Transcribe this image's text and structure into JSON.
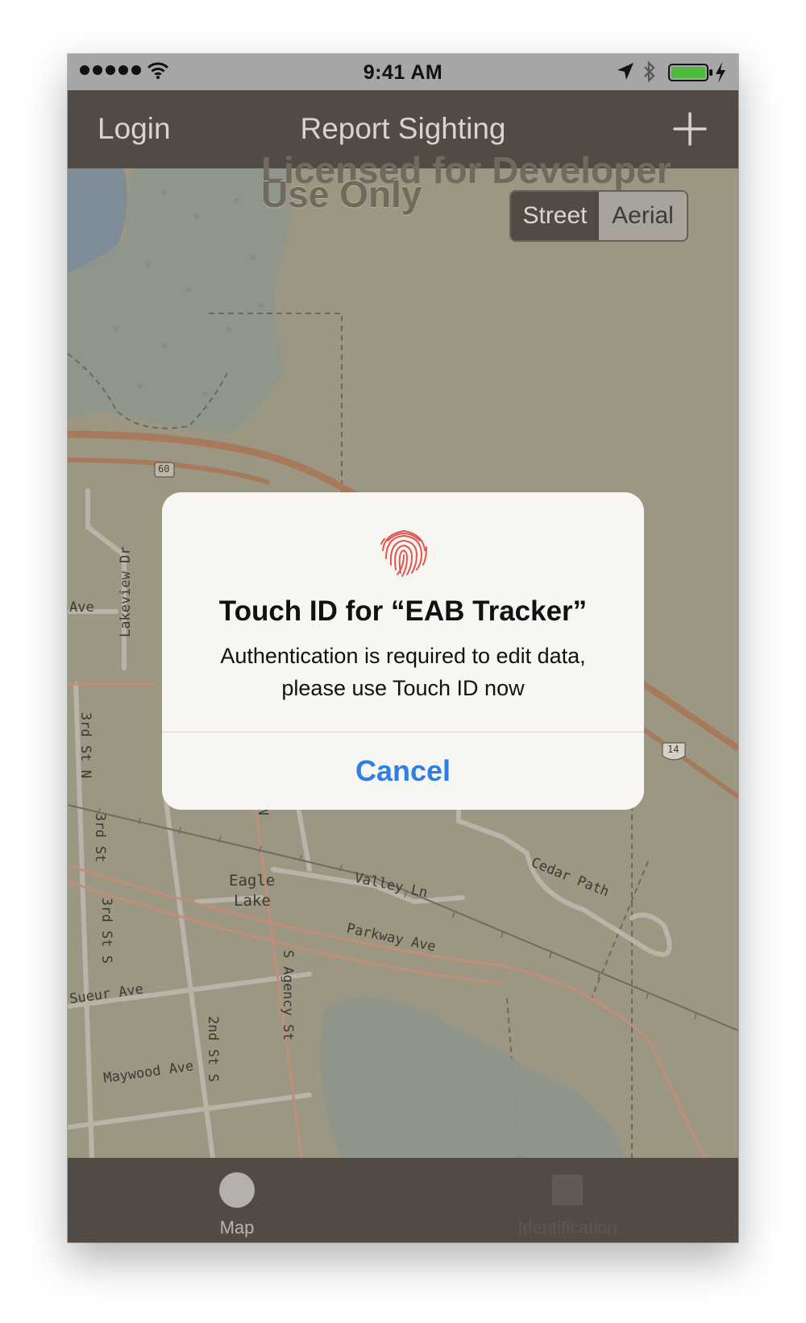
{
  "status_bar": {
    "time": "9:41 AM",
    "icons": [
      "signal-dots-icon",
      "wifi-icon",
      "location-arrow-icon",
      "bluetooth-icon",
      "battery-icon",
      "charging-icon"
    ],
    "battery_color": "#4cbb3a"
  },
  "nav_bar": {
    "left_label": "Login",
    "title": "Report Sighting",
    "right_icon": "plus-icon"
  },
  "map": {
    "watermark_top": "Licensed for Developer",
    "watermark_bottom": "Use Only",
    "basemap_toggle": [
      "Street",
      "Aerial"
    ],
    "selected_basemap": "Street",
    "labels": {
      "ave_left": "Ave",
      "lakeview_dr": "Lakeview Dr",
      "shield_60": "60",
      "shield_14": "14",
      "third_st_n": "3rd St N",
      "third_st": "3rd St",
      "third_st_s": "3rd St S",
      "n_partial": "N",
      "st_n": "St N",
      "eagle": "Eagle",
      "lake": "Lake",
      "valley_ln": "Valley Ln",
      "cedar_path": "Cedar Path",
      "parkway_ave": "Parkway Ave",
      "sueur_ave": "Sueur Ave",
      "s_agency_st": "S Agency St",
      "second_st_s": "2nd St S",
      "maywood_ave": "Maywood Ave"
    },
    "colors": {
      "overlay_tint": "#9c9783",
      "highway": "#a77a5c",
      "water": "#7d8c96"
    }
  },
  "dialog": {
    "icon": "fingerprint-icon",
    "title": "Touch ID for “EAB Tracker”",
    "message_line1": "Authentication is required to edit data,",
    "message_line2": "please use Touch ID now",
    "cancel_label": "Cancel",
    "accent": "#2e7fe3"
  },
  "tab_bar": {
    "tabs": [
      {
        "label": "Map",
        "icon": "map-circle-icon",
        "selected": true
      },
      {
        "label": "Identification",
        "icon": "identification-square-icon",
        "selected": false
      }
    ]
  }
}
